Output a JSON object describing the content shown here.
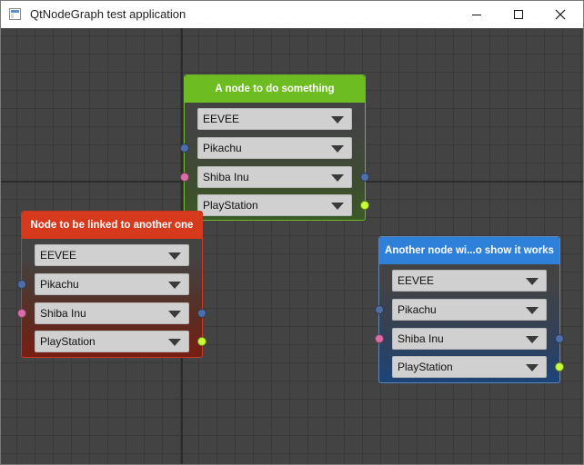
{
  "window": {
    "title": "QtNodeGraph test application"
  },
  "nodes": [
    {
      "title": "A node to do something",
      "color": "#6dbd22",
      "fields": [
        {
          "value": "EEVEE"
        },
        {
          "value": "Pikachu"
        },
        {
          "value": "Shiba Inu"
        },
        {
          "value": "PlayStation"
        }
      ]
    },
    {
      "title": "Node to be linked to another one",
      "color": "#d7391d",
      "fields": [
        {
          "value": "EEVEE"
        },
        {
          "value": "Pikachu"
        },
        {
          "value": "Shiba Inu"
        },
        {
          "value": "PlayStation"
        }
      ]
    },
    {
      "title": "Another node wi...o show it works",
      "color": "#2f80d8",
      "fields": [
        {
          "value": "EEVEE"
        },
        {
          "value": "Pikachu"
        },
        {
          "value": "Shiba Inu"
        },
        {
          "value": "PlayStation"
        }
      ]
    }
  ],
  "port_colors": {
    "blue": "#4d6ea6",
    "pink": "#d96ea7",
    "lime": "#c6ff3a"
  }
}
